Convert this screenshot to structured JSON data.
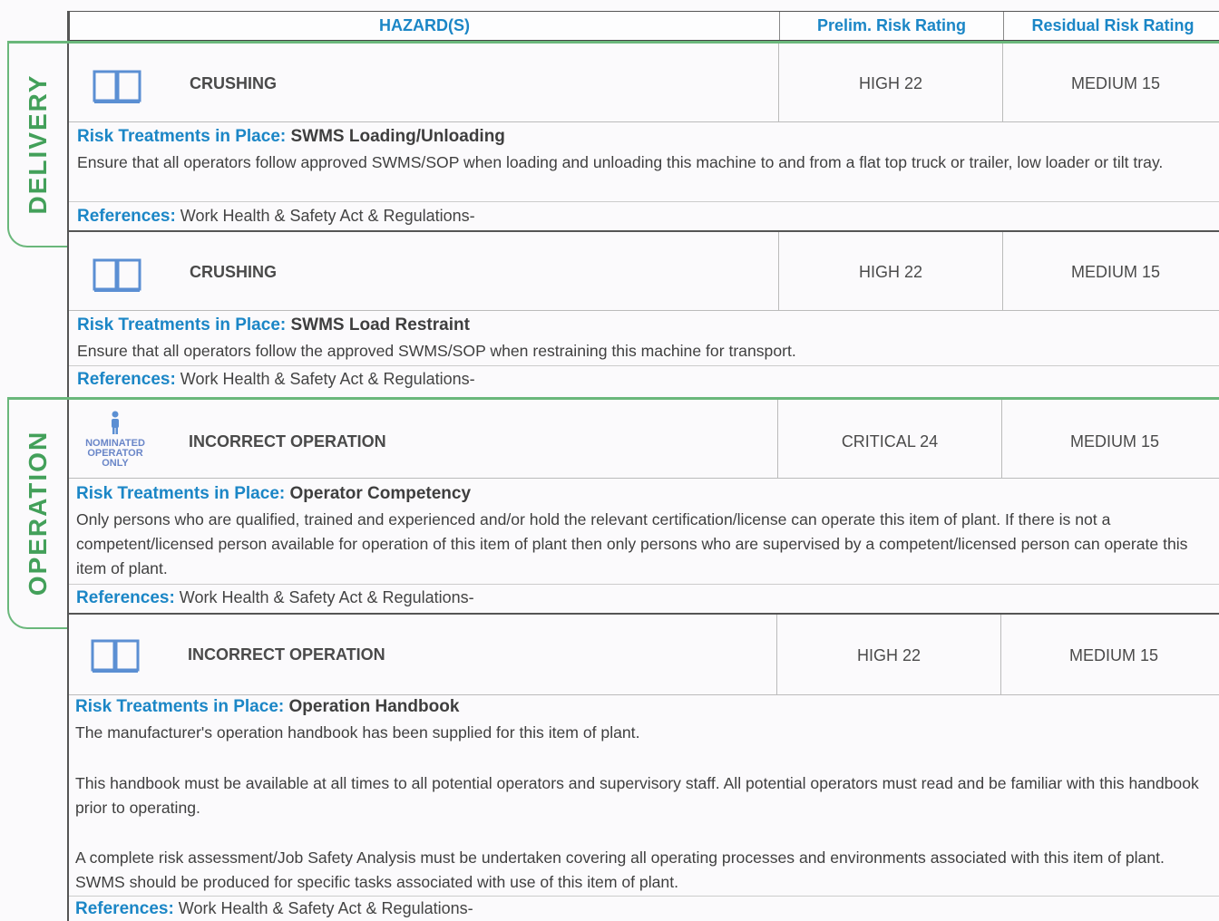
{
  "header": {
    "hazards": "HAZARD(S)",
    "prelim": "Prelim. Risk Rating",
    "residual": "Residual Risk Rating"
  },
  "sections": {
    "delivery": "DELIVERY",
    "operation": "OPERATION"
  },
  "labels": {
    "risk_treatments": "Risk Treatments in Place:",
    "references": "References:"
  },
  "icons": {
    "nominated_operator": [
      "NOMINATED",
      "OPERATOR",
      "ONLY"
    ]
  },
  "rows": [
    {
      "hazard": "CRUSHING",
      "icon": "book-icon",
      "prelim": "HIGH 22",
      "residual": "MEDIUM 15",
      "treatment": "SWMS Loading/Unloading",
      "text": [
        "Ensure that all operators follow approved SWMS/SOP when loading and unloading this machine to and from a flat top truck or trailer, low loader or tilt tray."
      ],
      "refs": "Work Health & Safety Act & Regulations-"
    },
    {
      "hazard": "CRUSHING",
      "icon": "book-icon",
      "prelim": "HIGH 22",
      "residual": "MEDIUM 15",
      "treatment": "SWMS Load Restraint",
      "text": [
        "Ensure that all operators follow the approved SWMS/SOP when restraining this machine for transport."
      ],
      "refs": "Work Health & Safety Act & Regulations-"
    },
    {
      "hazard": "INCORRECT OPERATION",
      "icon": "nominated-operator-icon",
      "prelim": "CRITICAL 24",
      "residual": "MEDIUM 15",
      "treatment": "Operator Competency",
      "text": [
        "Only persons who are qualified, trained and experienced and/or hold the relevant certification/license can operate this item of plant. If there is not a competent/licensed person available for operation of this item of plant then only persons who are supervised by a competent/licensed person can operate this item of plant."
      ],
      "refs": "Work Health & Safety Act & Regulations-"
    },
    {
      "hazard": "INCORRECT OPERATION",
      "icon": "book-icon",
      "prelim": "HIGH 22",
      "residual": "MEDIUM 15",
      "treatment": "Operation Handbook",
      "text": [
        "The manufacturer's operation handbook has been supplied for this item of plant.",
        "This handbook must be available at all times to all potential operators and supervisory staff. All potential operators must read and be familiar with this handbook prior to operating.",
        "A complete risk assessment/Job Safety Analysis must be undertaken covering all operating processes and environments associated with this item of plant. SWMS should be produced for specific tasks associated with use of this item of plant."
      ],
      "refs": "Work Health & Safety Act & Regulations-"
    }
  ]
}
